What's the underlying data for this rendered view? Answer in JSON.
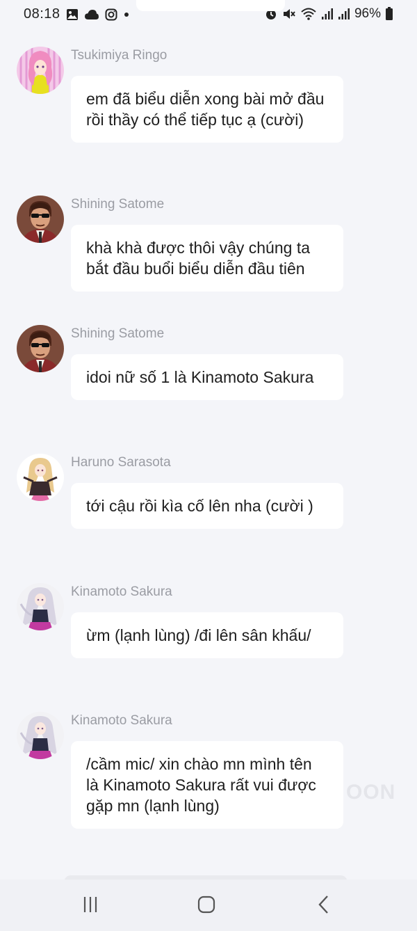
{
  "status_bar": {
    "time": "08:18",
    "battery": "96%",
    "left_icons": [
      "image-icon",
      "cloud-icon",
      "instagram-icon",
      "dot-icon"
    ],
    "right_icons": [
      "alarm-icon",
      "mute-icon",
      "wifi-icon",
      "signal-icon",
      "signal-icon",
      "battery-icon"
    ]
  },
  "messages": [
    {
      "sender": "Tsukimiya Ringo",
      "text": "em đã biểu diễn xong bài mở đầu rồi thầy có thể tiếp tục ạ (cười)"
    },
    {
      "sender": "Shining Satome",
      "text": "khà khà được thôi vậy chúng ta bắt đầu buổi biểu diễn đầu tiên"
    },
    {
      "sender": "Shining Satome",
      "text": "idoi nữ số 1 là Kinamoto Sakura"
    },
    {
      "sender": "Haruno Sarasota",
      "text": "tới cậu rồi kìa cố lên nha (cười )"
    },
    {
      "sender": "Kinamoto Sakura",
      "text": "ừm (lạnh lùng) /đi lên sân khấu/"
    },
    {
      "sender": "Kinamoto Sakura",
      "text": "/cầm mic/ xin chào mn mình tên là Kinamoto Sakura rất vui được gặp mn (lạnh lùng)"
    }
  ],
  "watermark": "OON",
  "nav_bar": {
    "recents_icon": "recents-icon",
    "home_icon": "home-icon",
    "back_icon": "back-icon"
  },
  "colors": {
    "background": "#f4f5f9",
    "bubble": "#ffffff",
    "sender_text": "#9a9ca3",
    "message_text": "#1e1e1e"
  }
}
